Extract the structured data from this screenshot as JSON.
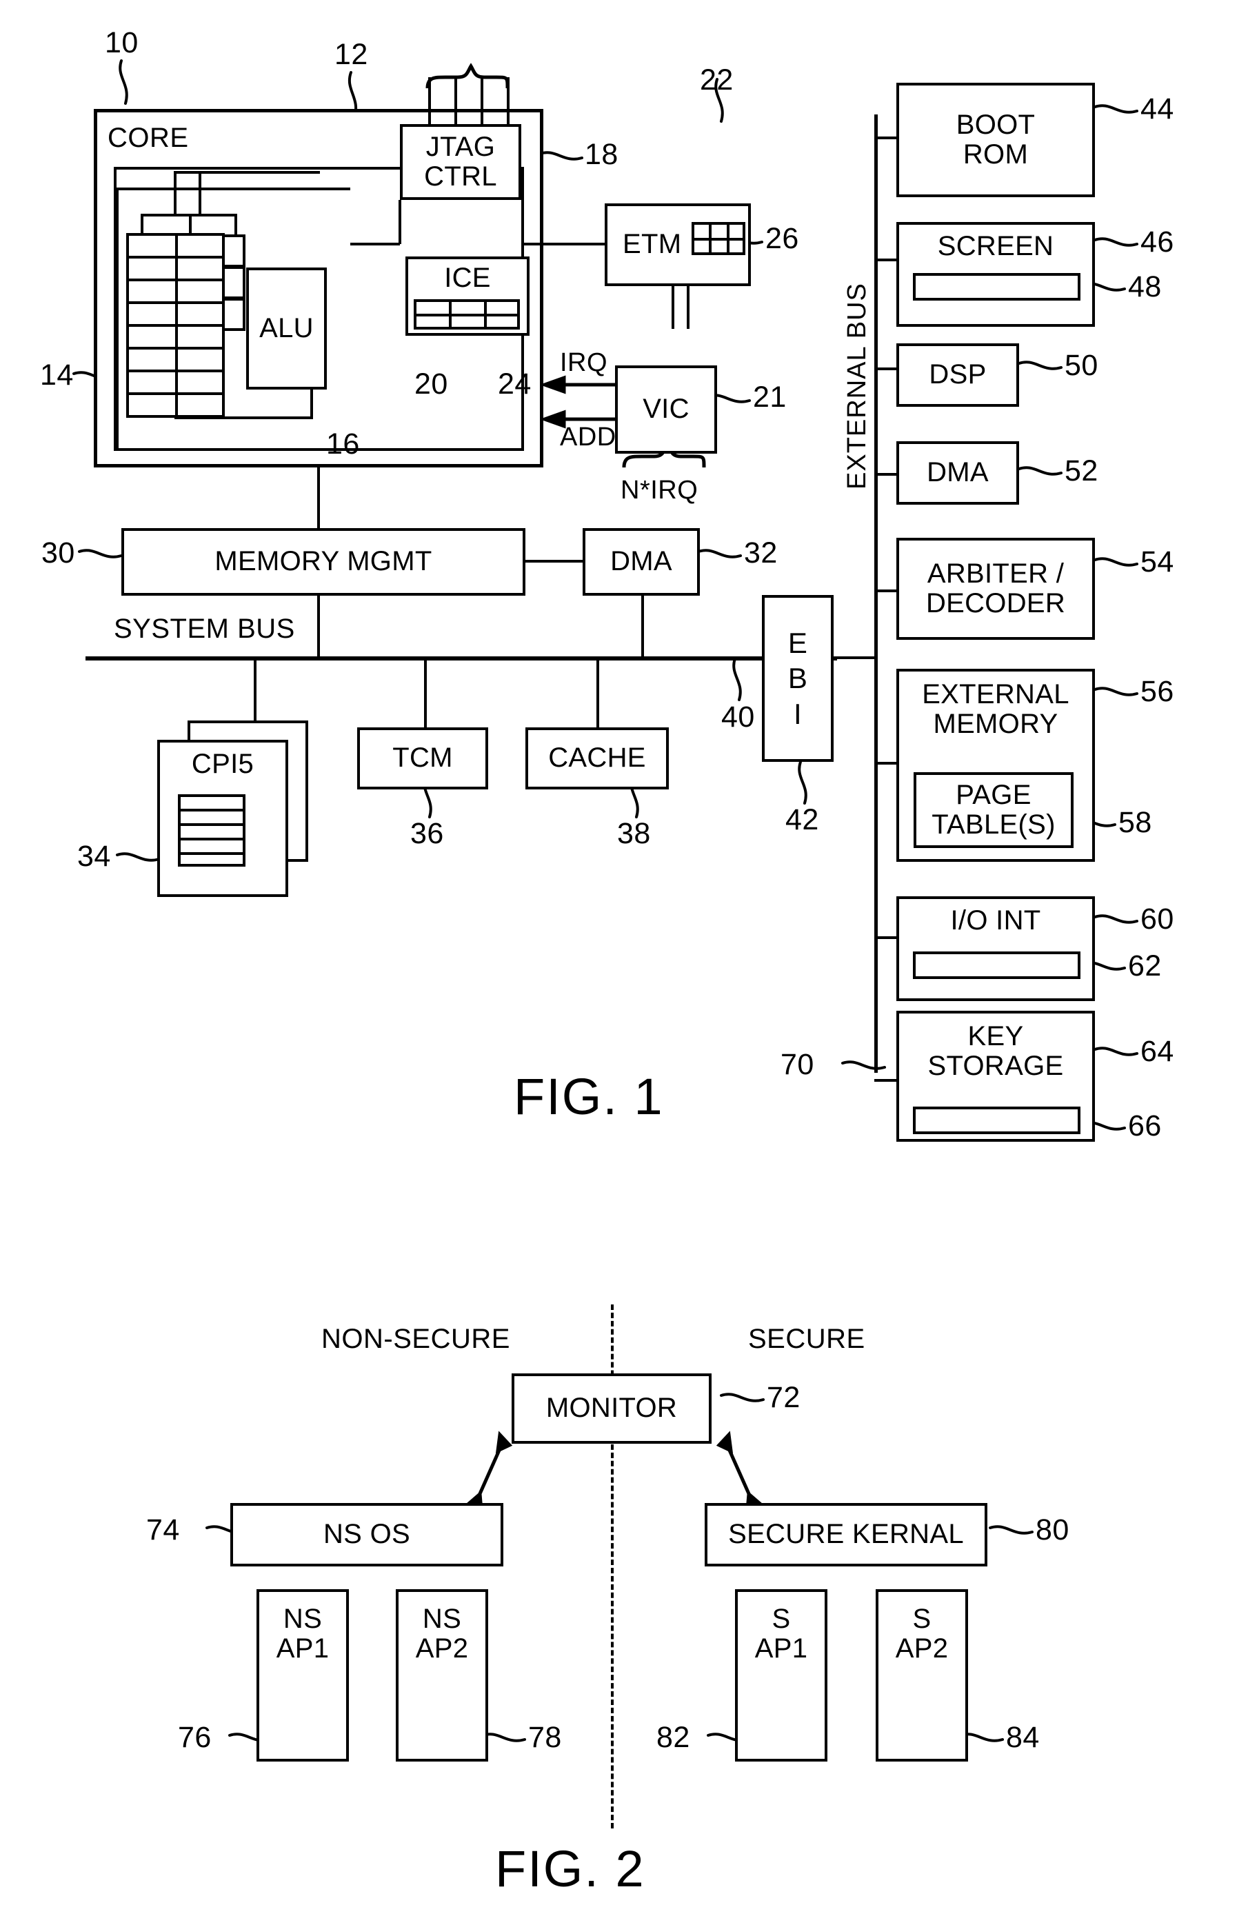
{
  "figures": [
    {
      "id": "fig1",
      "caption": "FIG. 1",
      "labels": {
        "core": "CORE",
        "alu": "ALU",
        "jtag_ctrl_line1": "JTAG",
        "jtag_ctrl_line2": "CTRL",
        "ice": "ICE",
        "etm": "ETM",
        "vic": "VIC",
        "irq": "IRQ",
        "add": "ADD",
        "n_irq": "N*IRQ",
        "memory_mgmt": "MEMORY MGMT",
        "dma_core": "DMA",
        "system_bus": "SYSTEM BUS",
        "cpi5": "CPI5",
        "tcm": "TCM",
        "cache": "CACHE",
        "ebi_line1": "E",
        "ebi_line2": "B",
        "ebi_line3": "I",
        "external_bus": "EXTERNAL BUS",
        "boot_rom_line1": "BOOT",
        "boot_rom_line2": "ROM",
        "screen": "SCREEN",
        "dsp": "DSP",
        "dma_ext": "DMA",
        "arbiter_line1": "ARBITER /",
        "arbiter_line2": "DECODER",
        "external_memory_line1": "EXTERNAL",
        "external_memory_line2": "MEMORY",
        "page_table_line1": "PAGE",
        "page_table_line2": "TABLE(S)",
        "io_int": "I/O INT",
        "key_storage_line1": "KEY",
        "key_storage_line2": "STORAGE"
      },
      "reference_numerals": {
        "r10": "10",
        "r12": "12",
        "r14": "14",
        "r16": "16",
        "r18": "18",
        "r20": "20",
        "r21": "21",
        "r22": "22",
        "r24": "24",
        "r26": "26",
        "r30": "30",
        "r32": "32",
        "r34": "34",
        "r36": "36",
        "r38": "38",
        "r40": "40",
        "r42": "42",
        "r44": "44",
        "r46": "46",
        "r48": "48",
        "r50": "50",
        "r52": "52",
        "r54": "54",
        "r56": "56",
        "r58": "58",
        "r60": "60",
        "r62": "62",
        "r64": "64",
        "r66": "66",
        "r70": "70"
      }
    },
    {
      "id": "fig2",
      "caption": "FIG. 2",
      "labels": {
        "non_secure": "NON-SECURE",
        "secure": "SECURE",
        "monitor": "MONITOR",
        "ns_os": "NS OS",
        "secure_kernal": "SECURE KERNAL",
        "ns_ap1_line1": "NS",
        "ns_ap1_line2": "AP1",
        "ns_ap2_line1": "NS",
        "ns_ap2_line2": "AP2",
        "s_ap1_line1": "S",
        "s_ap1_line2": "AP1",
        "s_ap2_line1": "S",
        "s_ap2_line2": "AP2"
      },
      "reference_numerals": {
        "r72": "72",
        "r74": "74",
        "r76": "76",
        "r78": "78",
        "r80": "80",
        "r82": "82",
        "r84": "84"
      }
    }
  ],
  "style": {
    "ink": "#000000",
    "paper": "#ffffff"
  }
}
